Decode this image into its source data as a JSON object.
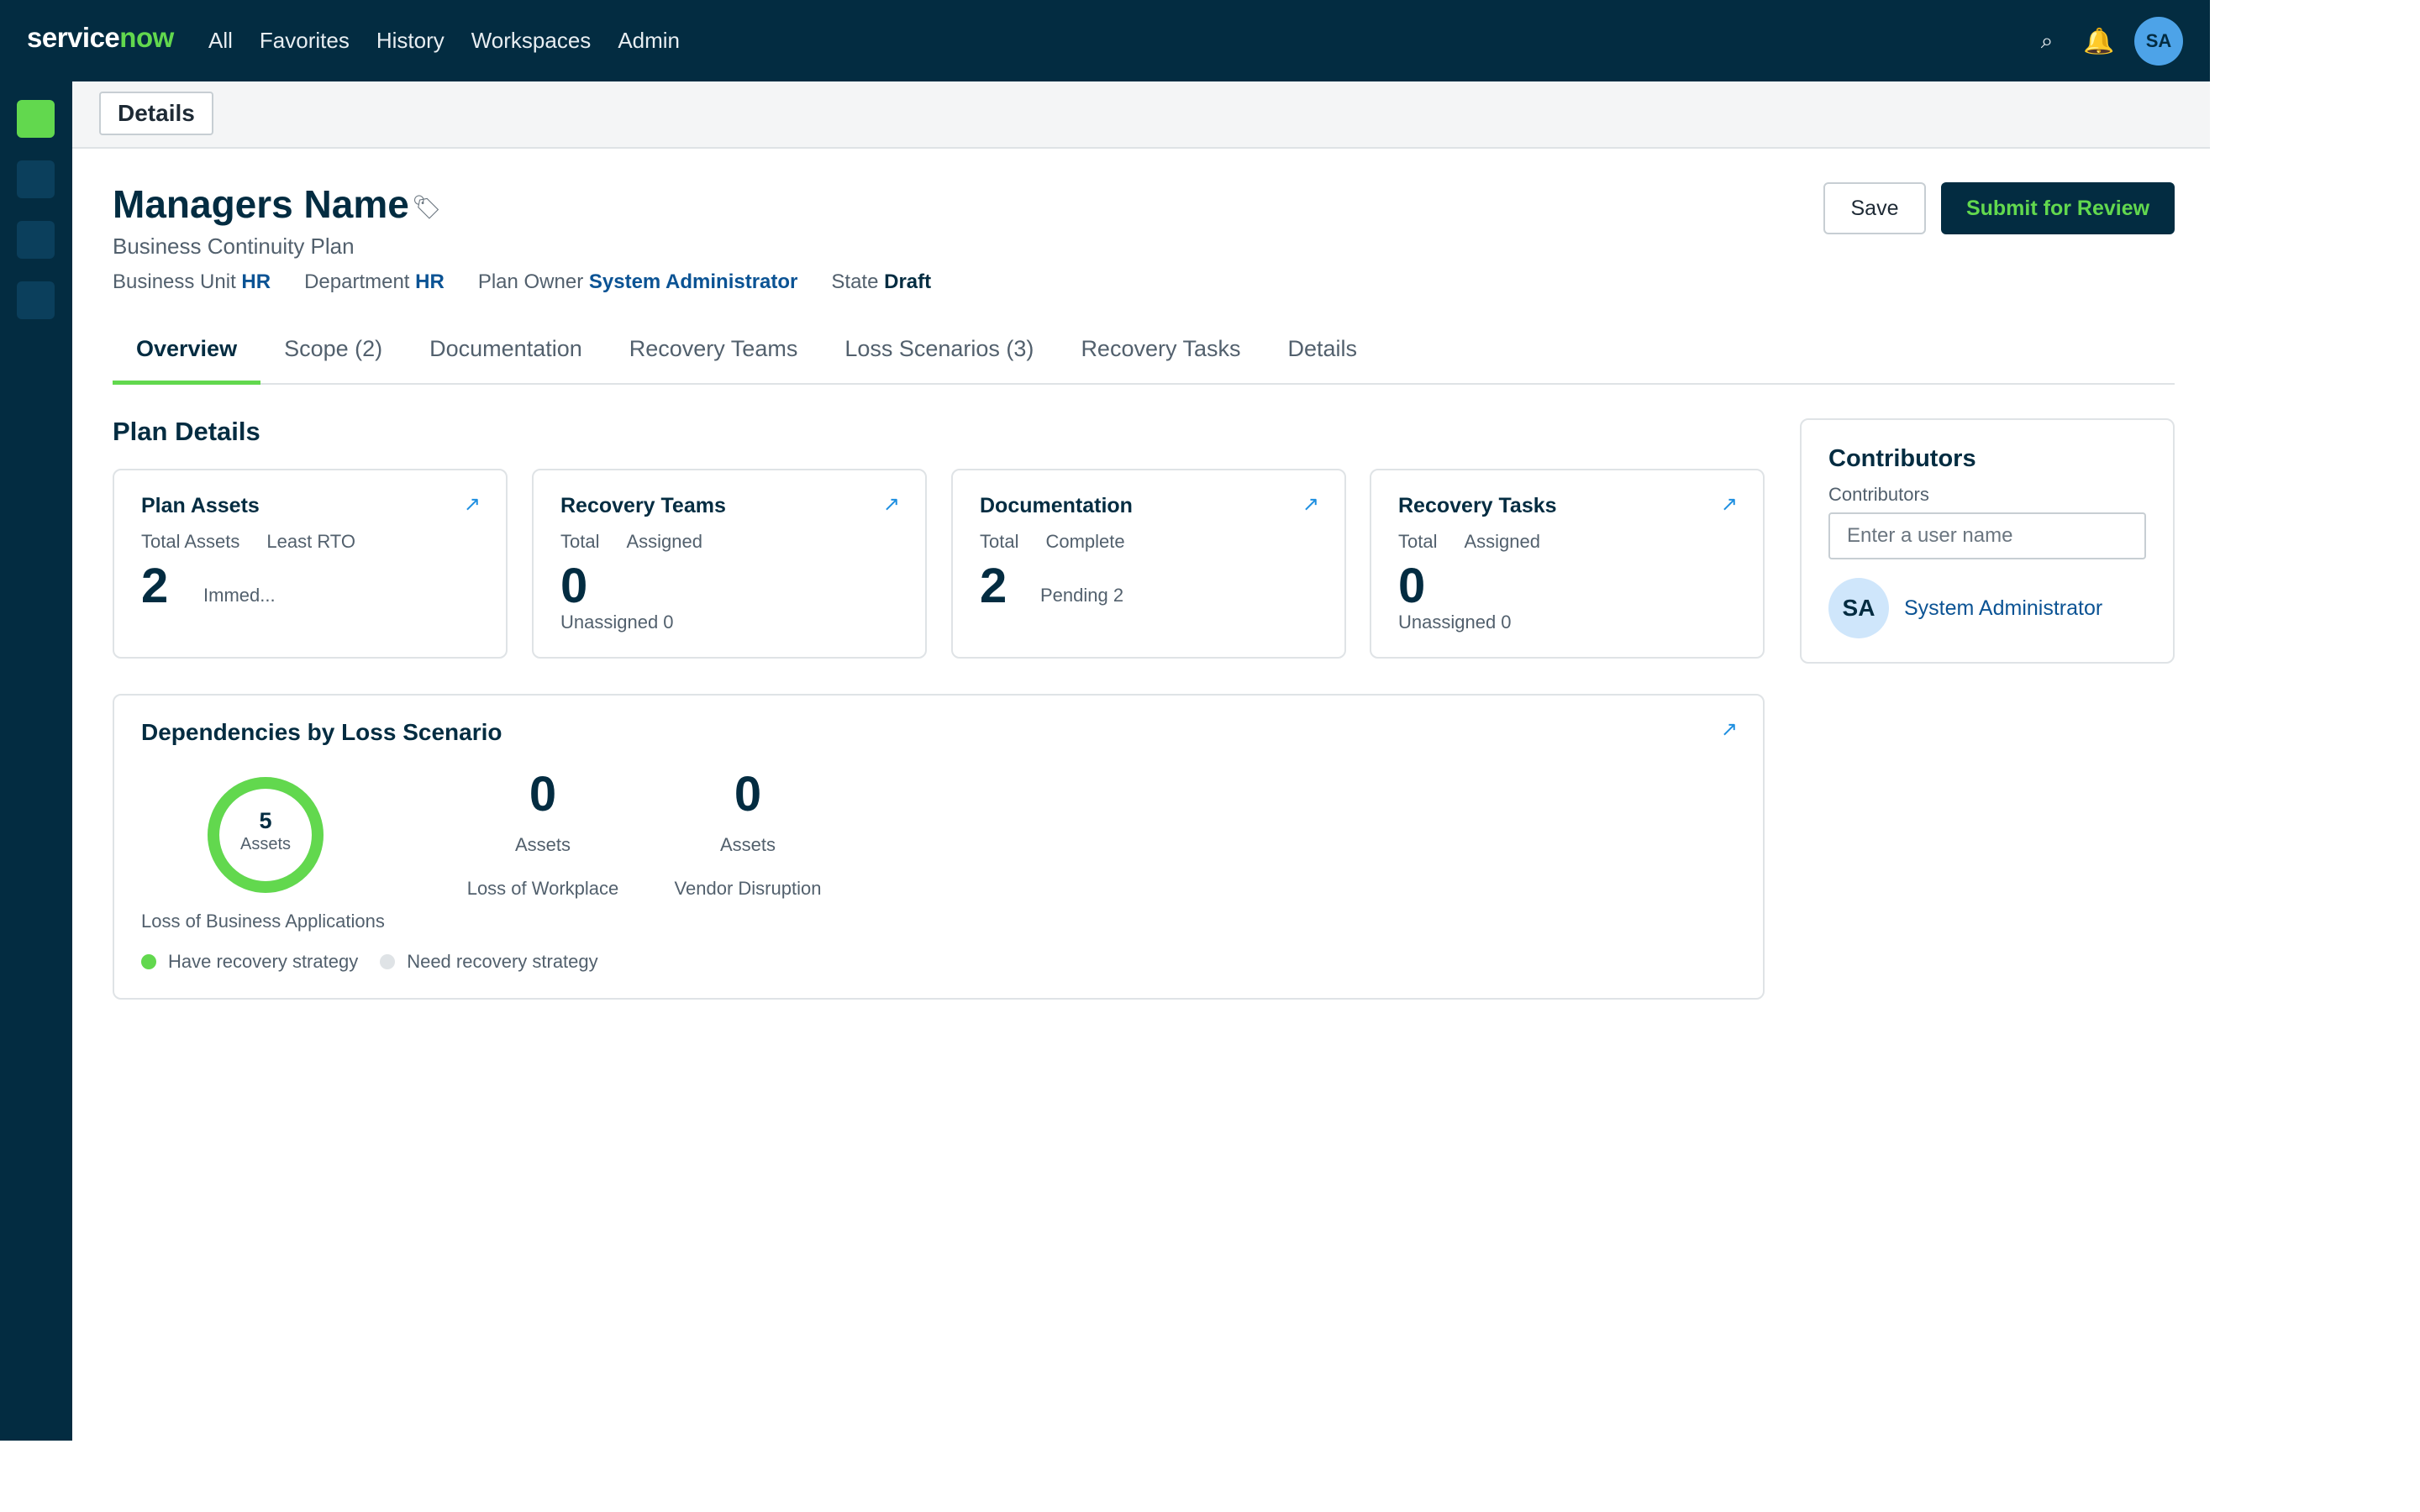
{
  "nav": {
    "logo_part1": "service",
    "logo_part2": "now",
    "links": [
      "All",
      "Favorites",
      "History",
      "Workspaces",
      "Admin"
    ],
    "search_glyph": "⌕",
    "bell_glyph": "🔔",
    "avatar_initials": "SA"
  },
  "subheader": {
    "tab_label": "Details"
  },
  "record": {
    "title": "Managers Name",
    "tag_glyph": "🏷",
    "subtitle": "Business Continuity Plan",
    "meta": [
      {
        "label": "Business Unit",
        "value": "HR"
      },
      {
        "label": "Department",
        "value": "HR"
      },
      {
        "label": "Plan Owner",
        "value": "System Administrator"
      },
      {
        "label": "State",
        "value": "Draft"
      }
    ]
  },
  "actions": {
    "save_label": "Save",
    "submit_label": "Submit for Review"
  },
  "tabs": [
    "Overview",
    "Scope (2)",
    "Documentation",
    "Recovery Teams",
    "Loss Scenarios (3)",
    "Recovery Tasks",
    "Details"
  ],
  "plan_details": {
    "title": "Plan Details",
    "link_glyph": "↗",
    "cards": [
      {
        "title": "Plan Assets",
        "label1": "Total Assets",
        "label2": "Least RTO",
        "big": "2",
        "side": "Immed...",
        "foot": ""
      },
      {
        "title": "Recovery Teams",
        "label1": "Total",
        "label2": "Assigned",
        "big": "0",
        "side": "",
        "foot": "Unassigned 0"
      },
      {
        "title": "Documentation",
        "label1": "Total",
        "label2": "Complete",
        "big": "2",
        "side": "Pending 2",
        "foot": ""
      },
      {
        "title": "Recovery Tasks",
        "label1": "Total",
        "label2": "Assigned",
        "big": "0",
        "side": "",
        "foot": "Unassigned 0"
      }
    ]
  },
  "dependencies": {
    "title": "Dependencies by Loss Scenario",
    "donut_value": "5",
    "donut_unit": "Assets",
    "donut_caption": "Loss of Business Applications",
    "have_fraction": 1.0,
    "stats": [
      {
        "value": "0",
        "unit": "Assets",
        "caption": "Loss of Workplace"
      },
      {
        "value": "0",
        "unit": "Assets",
        "caption": "Vendor Disruption"
      }
    ],
    "legend": [
      {
        "label": "Have recovery strategy",
        "color": "#62d84e"
      },
      {
        "label": "Need recovery strategy",
        "color": "#dfe3e6"
      }
    ]
  },
  "contributors": {
    "title": "Contributors",
    "label": "Contributors",
    "placeholder": "Enter a user name",
    "user_initials": "SA",
    "user_name": "System Administrator"
  },
  "colors": {
    "brand_dark": "#032c41",
    "accent_green": "#62d84e",
    "link_blue": "#0b5394"
  }
}
